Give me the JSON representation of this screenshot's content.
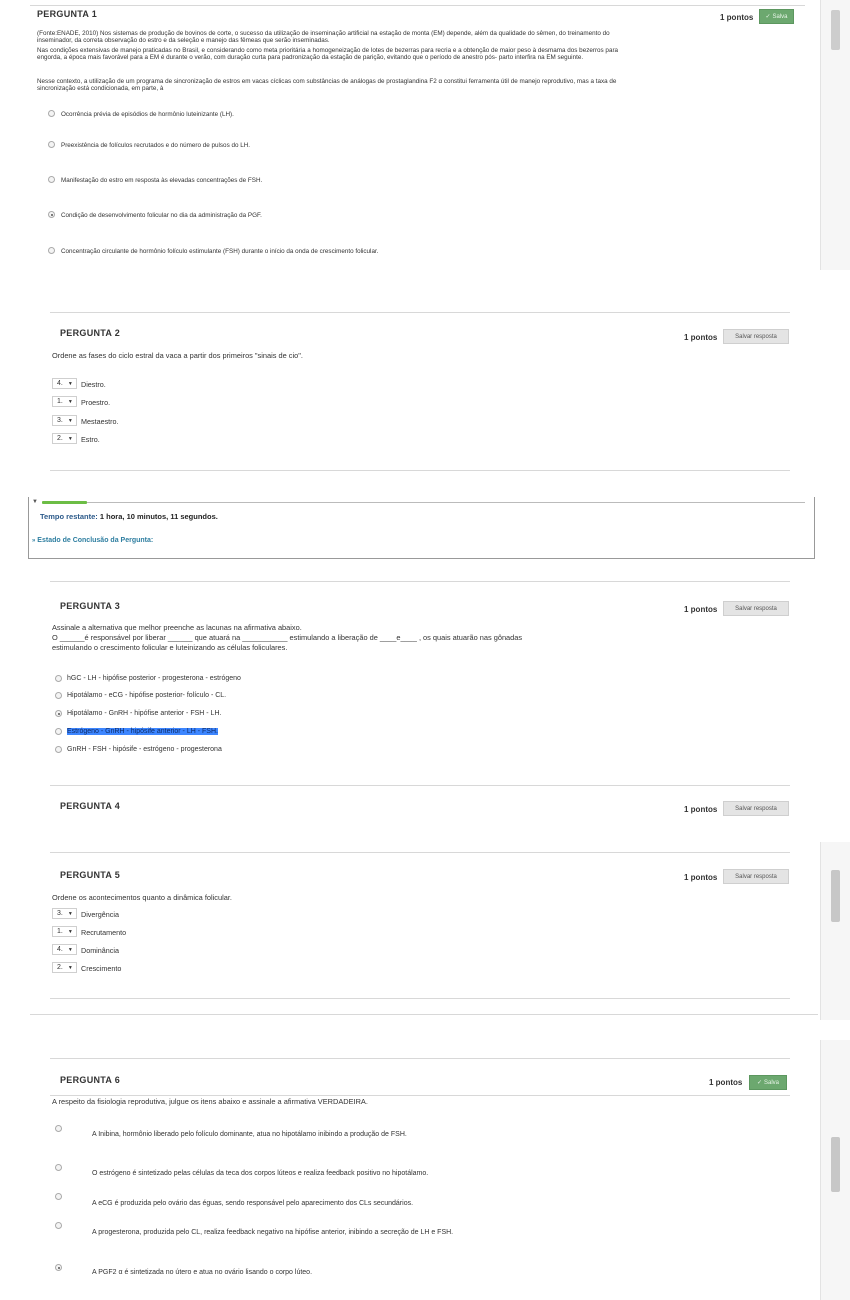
{
  "q1": {
    "title": "PERGUNTA 1",
    "points": "1 pontos",
    "save_label": "Salva",
    "p1": "(Fonte:ENADE, 2010) Nos sistemas de produção de bovinos de corte, o sucesso da utilização de inseminação artificial na estação de monta (EM) depende, além da qualidade do sêmen, do treinamento do inseminador, da correta observação do estro e da seleção e manejo das fêmeas que serão inseminadas.",
    "p2": "Nas condições extensivas de manejo praticadas no Brasil, e considerando como meta prioritária a homogeneização de lotes de bezerras para recria e a obtenção de maior peso à desmama dos bezerros para engorda, a época mais favorável para a EM é durante o verão, com duração curta para padronização da estação de parição, evitando que o período de anestro pós- parto interfira na EM seguinte.",
    "p3": "Nesse contexto, a utilização de um programa de sincronização de estros em vacas cíclicas com substâncias de análogas de prostaglandina F2 α constitui ferramenta útil de manejo reprodutivo, mas a taxa de sincronização está condicionada, em parte, à",
    "options": [
      "Ocorrência prévia de episódios de hormônio luteinizante (LH).",
      "Preexistência de folículos recrutados e do número de pulsos do LH.",
      "Manifestação do estro em resposta às elevadas concentrações de FSH.",
      "Condição de desenvolvimento folicular no dia da administração da PGF.",
      "Concentração circulante de hormônio folículo estimulante (FSH) durante o início da onda de crescimento folicular."
    ]
  },
  "q2": {
    "title": "PERGUNTA 2",
    "points": "1 pontos",
    "save_label": "Salvar resposta",
    "prompt": "Ordene as fases do ciclo estral da vaca a partir dos primeiros \"sinais de cio\".",
    "items": [
      {
        "value": "4.",
        "label": "Diestro."
      },
      {
        "value": "1.",
        "label": "Proestro."
      },
      {
        "value": "3.",
        "label": "Mestaestro."
      },
      {
        "value": "2.",
        "label": "Estro."
      }
    ]
  },
  "timer": {
    "label": "Tempo restante:",
    "value": "1 hora, 10 minutos, 11 segundos.",
    "status_link": "Estado de Conclusão da Pergunta:"
  },
  "q3": {
    "title": "PERGUNTA 3",
    "points": "1 pontos",
    "save_label": "Salvar resposta",
    "prompt": "Assinale a alternativa que melhor preenche as lacunas na afirmativa abaixo.",
    "line1": "O ______é responsável por liberar ______ que atuará na ___________ estimulando a liberação de ____e____ , os quais atuarão nas gônadas",
    "line2": "estimulando o crescimento folicular e luteinizando as células foliculares.",
    "options": [
      "hGC - LH - hipófise posterior - progesterona - estrógeno",
      "Hipotálamo - eCG - hipófise posterior- folículo - CL.",
      "Hipotálamo - GnRH - hipófise anterior - FSH - LH.",
      "Estrógeno - GnRH - hipósife anterior - LH - FSH.",
      "GnRH - FSH - hipósife - estrógeno - progesterona"
    ]
  },
  "q4": {
    "title": "PERGUNTA 4",
    "points": "1 pontos",
    "save_label": "Salvar resposta"
  },
  "q5": {
    "title": "PERGUNTA 5",
    "points": "1 pontos",
    "save_label": "Salvar resposta",
    "prompt": "Ordene os acontecimentos quanto a dinâmica folicular.",
    "items": [
      {
        "value": "3.",
        "label": "Divergência"
      },
      {
        "value": "1.",
        "label": "Recrutamento"
      },
      {
        "value": "4.",
        "label": "Dominância"
      },
      {
        "value": "2.",
        "label": "Crescimento"
      }
    ]
  },
  "q6": {
    "title": "PERGUNTA 6",
    "points": "1 pontos",
    "save_label": "Salva",
    "prompt": "A respeito da fisiologia reprodutiva, julgue os itens abaixo e assinale a afirmativa VERDADEIRA.",
    "options": [
      "A Inibina, hormônio liberado pelo folículo dominante, atua no hipotálamo inibindo a produção de FSH.",
      "O estrógeno é sintetizado pelas células da teca dos corpos lúteos e realiza feedback positivo no hipotálamo.",
      "A eCG é produzida pelo ovário das éguas, sendo responsável pelo aparecimento dos CLs secundários.",
      "A progesterona, produzida pelo CL, realiza feedback negativo na hipófise anterior, inibindo a secreção de LH e FSH.",
      "A PGF2 α é sintetizada no útero e atua no ovário lisando o corpo lúteo."
    ]
  },
  "selections": {
    "q1": 3,
    "q3": 2,
    "q6": 4
  }
}
